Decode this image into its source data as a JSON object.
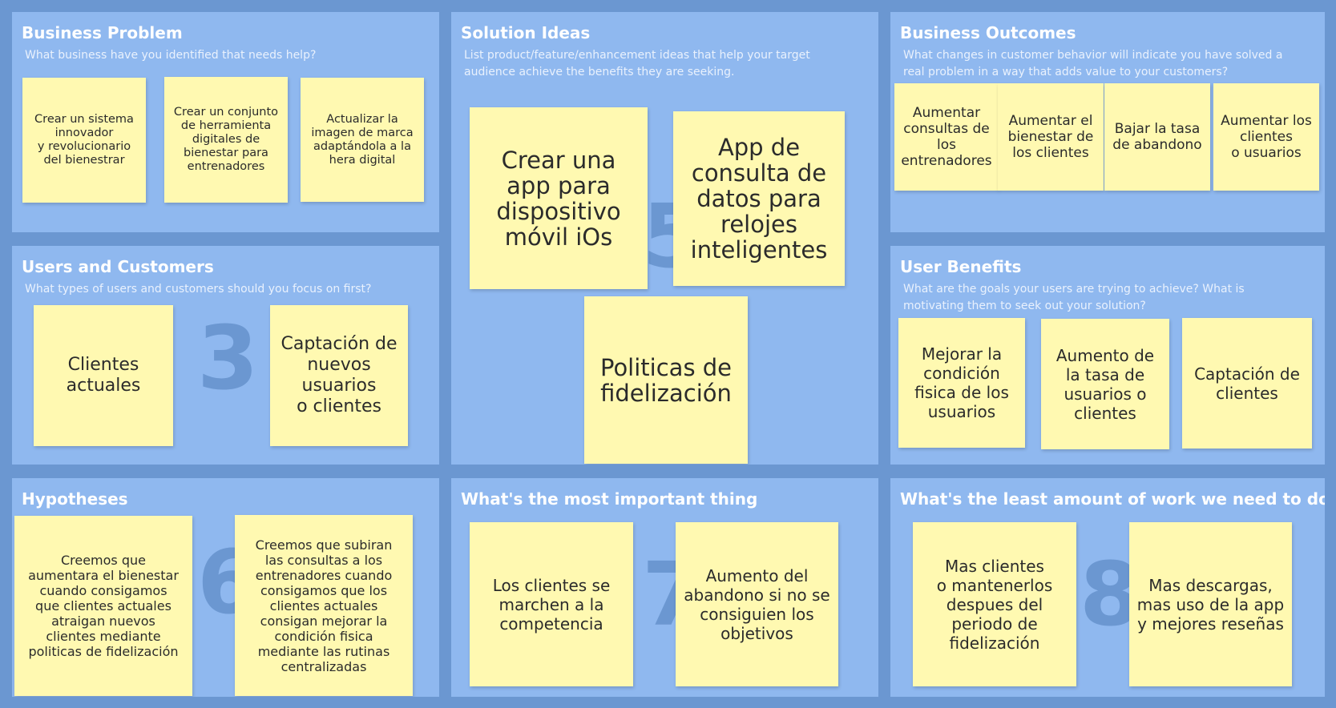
{
  "panels": {
    "business_problem": {
      "title": "Business Problem",
      "subtitle": "What business have you identified that needs help?",
      "stickies": [
        "Crear un sistema\ninnovador\ny revolucionario\ndel bienestrar",
        "Crear un conjunto\nde herramienta\ndigitales de\nbienestar para\nentrenadores",
        "Actualizar la\nimagen de marca\nadaptándola a la\nhera digital"
      ]
    },
    "solution_ideas": {
      "title": "Solution Ideas",
      "subtitle": "List product/feature/enhancement ideas that help your target audience achieve the benefits they are seeking.",
      "number": "5",
      "stickies": [
        "Crear una\napp para\ndispositivo\nmóvil iOs",
        "App de\nconsulta de\ndatos para\nrelojes\ninteligentes",
        "Politicas de\nfidelización"
      ]
    },
    "business_outcomes": {
      "title": "Business Outcomes",
      "subtitle": "What changes in customer behavior will indicate you have solved a real problem in a way that adds value to your customers?",
      "stickies": [
        "Aumentar\nconsultas de\nlos\nentrenadores",
        "Aumentar el\nbienestar de\nlos clientes",
        "Bajar la tasa\nde abandono",
        "Aumentar los\nclientes\no usuarios"
      ]
    },
    "users_customers": {
      "title": "Users and Customers",
      "subtitle": "What types of users and customers should you focus on first?",
      "number": "3",
      "stickies": [
        "Clientes\nactuales",
        "Captación de\nnuevos\nusuarios\no clientes"
      ]
    },
    "user_benefits": {
      "title": "User Benefits",
      "subtitle": "What are the goals your users are trying to achieve? What is motivating them to seek out your solution?",
      "stickies": [
        "Mejorar la\ncondición\nfisica de los\nusuarios",
        "Aumento de\nla tasa de\nusuarios o\nclientes",
        "Captación de\nclientes"
      ]
    },
    "hypotheses": {
      "title": "Hypotheses",
      "number": "6",
      "stickies": [
        "Creemos que\naumentara el bienestar\ncuando consigamos\nque clientes actuales\natraigan nuevos\nclientes mediante\npoliticas de fidelización",
        "Creemos que subiran\nlas consultas a los\nentrenadores cuando\nconsigamos que los\nclientes actuales\nconsigan mejorar la\ncondición fisica\nmediante las rutinas\ncentralizadas"
      ]
    },
    "most_important": {
      "title": "What's the most important thing",
      "number": "7",
      "stickies": [
        "Los clientes se\nmarchen a la\ncompetencia",
        "Aumento del\nabandono si no se\nconsiguien los\nobjetivos"
      ]
    },
    "least_work": {
      "title": "What's the least amount of work we need to do",
      "number": "8",
      "stickies": [
        "Mas clientes\no mantenerlos\ndespues del\nperiodo de\nfidelización",
        "Mas descargas,\nmas uso de la app\ny mejores reseñas"
      ]
    }
  },
  "colors": {
    "board_background": "#6b97d1",
    "panel_background": "#8fb8ef",
    "sticky_yellow": "#fff9b1",
    "number_color": "#6b97d1"
  }
}
